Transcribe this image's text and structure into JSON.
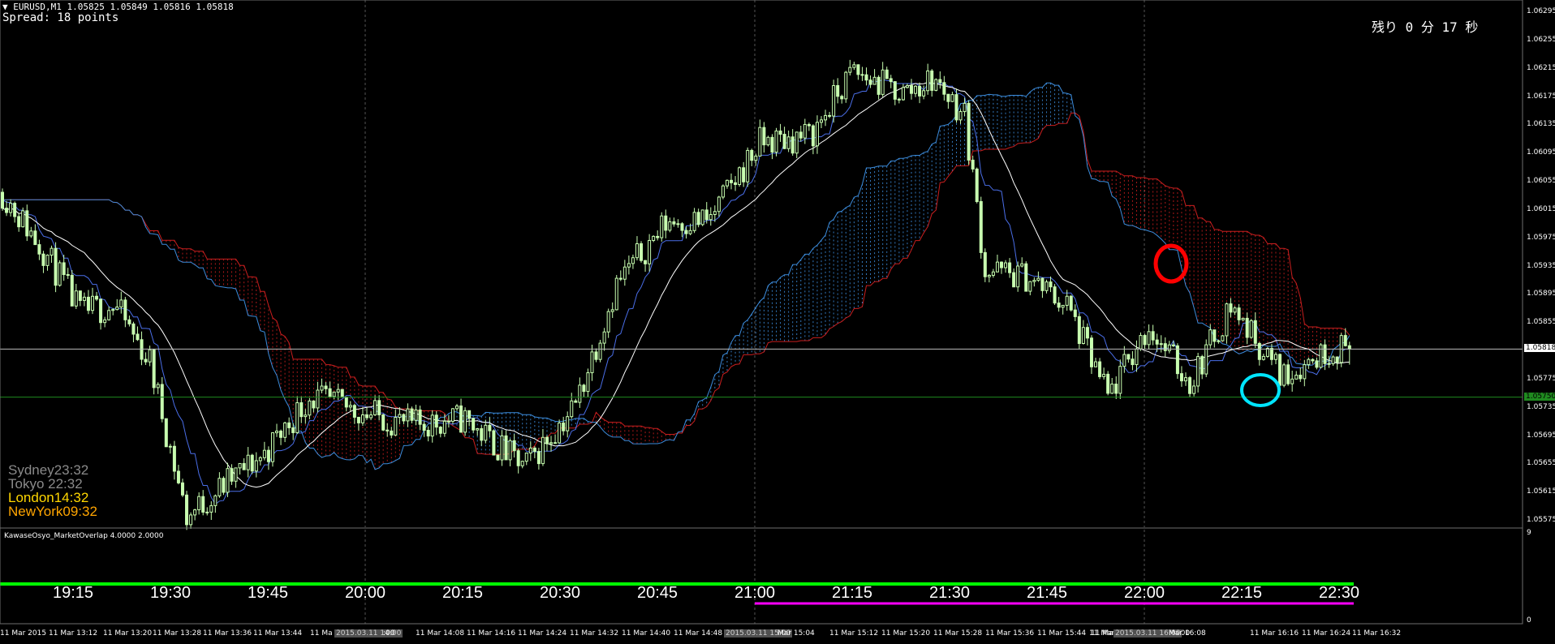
{
  "header": {
    "symbol_line": "▼ EURUSD,M1  1.05825 1.05849 1.05816 1.05818",
    "spread": "Spread: 18 points"
  },
  "countdown": "残り  0 分  17 秒",
  "sessions": [
    {
      "text": "Sydney23:32",
      "color": "#8a8a8a"
    },
    {
      "text": "Tokyo 22:32",
      "color": "#8a8a8a"
    },
    {
      "text": "London14:32",
      "color": "#ffd700"
    },
    {
      "text": "NewYork09:32",
      "color": "#ffa500"
    }
  ],
  "price_axis": {
    "labels": [
      "1.06295",
      "1.06255",
      "1.06215",
      "1.06175",
      "1.06135",
      "1.06095",
      "1.06055",
      "1.06015",
      "1.05975",
      "1.05935",
      "1.05895",
      "1.05855",
      "1.05815",
      "1.05775",
      "1.05735",
      "1.05695",
      "1.05655",
      "1.05615",
      "1.05575"
    ],
    "current_price": "1.05818",
    "marker_line_price": "1.05750"
  },
  "indicator": {
    "title": "KawaseOsyo_MarketOverlap 4.0000 2.0000",
    "scale_top": "9",
    "scale_bottom": "0"
  },
  "hour_labels": [
    "19:15",
    "19:30",
    "19:45",
    "20:00",
    "20:15",
    "20:30",
    "20:45",
    "21:00",
    "21:15",
    "21:30",
    "21:45",
    "22:00",
    "22:15",
    "22:30"
  ],
  "time_axis": {
    "labels": [
      "11 Mar 2015",
      "11 Mar 13:12",
      "11 Mar 13:20",
      "11 Mar 13:28",
      "11 Mar 13:36",
      "11 Mar 13:44",
      "11 Ma",
      "2015.03.11 14:00",
      ":00",
      "11 Mar 14:08",
      "11 Mar 14:16",
      "11 Mar 14:24",
      "11 Mar 14:32",
      "11 Mar 14:40",
      "11 Mar 14:48",
      "2015.03.11 15:00",
      "Mar 15:04",
      "11 Mar 15:12",
      "11 Mar 15:20",
      "11 Mar 15:28",
      "11 Mar 15:36",
      "11 Mar 15:44",
      "11 Mar 15:52",
      "11 Mar 16:00",
      "11 Ma",
      "2015.03.11 16:00",
      "Mar 16:08",
      "11 Mar 16:16",
      "11 Mar 16:24",
      "11 Mar 16:32"
    ]
  },
  "colors": {
    "background": "#000000",
    "candle": "#c8ffb0",
    "grid": "#555555",
    "kumo_bear": "#c81e1e",
    "kumo_bull": "#3c8cdc",
    "tenkan": "#4a6ee8",
    "moving_average": "#ffffff",
    "current_price_line": "#bbbbbb",
    "marker_line": "#1f8a1f",
    "overlap_line": "#00ff00",
    "newyork_bar": "#ff00ff",
    "red_circle": "#ff0000",
    "cyan_circle": "#00e5ff"
  }
}
